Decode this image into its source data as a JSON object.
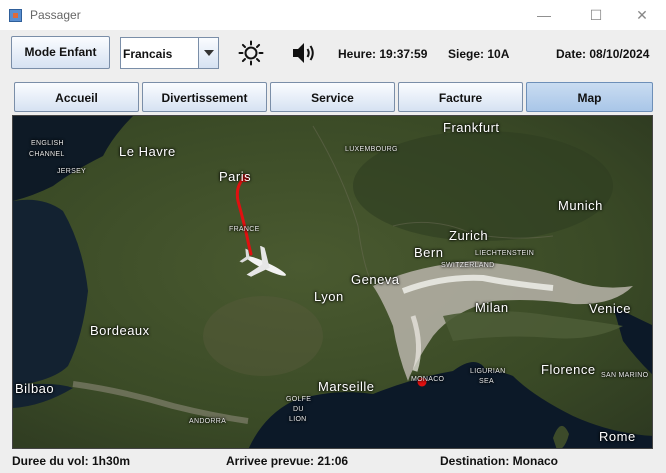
{
  "window": {
    "title": "Passager",
    "minimize": "—",
    "maximize": "☐",
    "close": "✕"
  },
  "toolbar": {
    "mode_label": "Mode Enfant",
    "language": {
      "selected": "Francais"
    },
    "brightness_icon": "sun-icon",
    "volume_icon": "speaker-icon",
    "heure": "Heure: 19:37:59",
    "siege": "Siege: 10A",
    "date": "Date: 08/10/2024"
  },
  "tabs": [
    {
      "label": "Accueil",
      "active": false
    },
    {
      "label": "Divertissement",
      "active": false
    },
    {
      "label": "Service",
      "active": false
    },
    {
      "label": "Facture",
      "active": false
    },
    {
      "label": "Map",
      "active": true
    }
  ],
  "map": {
    "cities": {
      "frankfurt": "Frankfurt",
      "le_havre": "Le Havre",
      "paris": "Paris",
      "munich": "Munich",
      "zurich": "Zurich",
      "bern": "Bern",
      "geneva": "Geneva",
      "lyon": "Lyon",
      "milan": "Milan",
      "venice": "Venice",
      "bordeaux": "Bordeaux",
      "bilbao": "Bilbao",
      "marseille": "Marseille",
      "florence": "Florence",
      "rome": "Rome"
    },
    "regions": {
      "english_channel_1": "ENGLISH",
      "english_channel_2": "CHANNEL",
      "jersey": "JERSEY",
      "luxembourg": "LUXEMBOURG",
      "france": "FRANCE",
      "switzerland": "SWITZERLAND",
      "liechtenstein": "LIECHTENSTEIN",
      "monaco": "MONACO",
      "ligurian_1": "LIGURIAN",
      "ligurian_2": "SEA",
      "golfe_1": "GOLFE",
      "golfe_2": "DU",
      "golfe_3": "LION",
      "san_marino": "SAN MARINO",
      "andorra": "ANDORRA"
    },
    "route_color": "#e01010",
    "origin": "Paris",
    "destination": "Monaco"
  },
  "status": {
    "duree": "Duree du vol: 1h30m",
    "arrivee": "Arrivee prevue: 21:06",
    "destination": "Destination: Monaco"
  }
}
